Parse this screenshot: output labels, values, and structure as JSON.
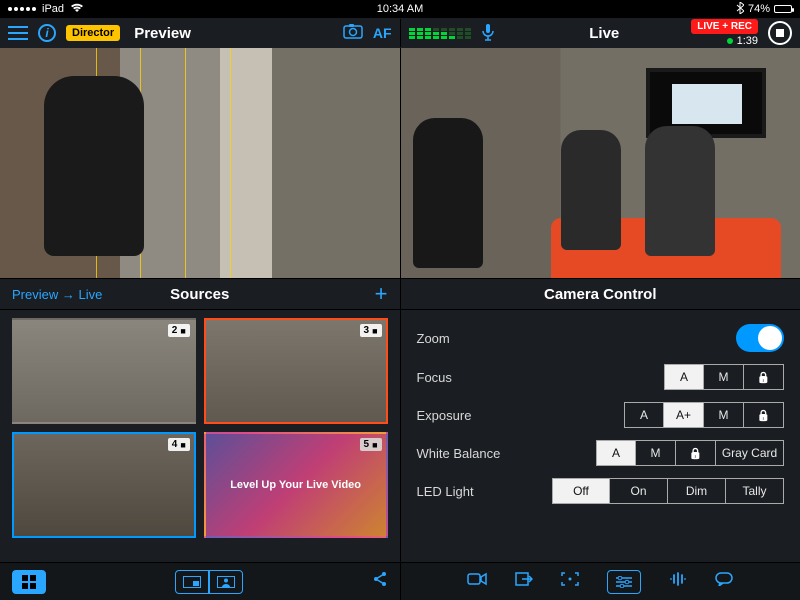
{
  "statusbar": {
    "device": "iPad",
    "time": "10:34 AM",
    "battery": "74%"
  },
  "header": {
    "director_badge": "Director",
    "preview_title": "Preview",
    "af_label": "AF",
    "live_title": "Live",
    "live_badge": "LIVE + REC",
    "rec_time": "1:39"
  },
  "section": {
    "preview_to_live": "Preview → Live",
    "sources_title": "Sources",
    "camera_control_title": "Camera Control"
  },
  "sources": [
    {
      "index": "2",
      "selected": "none"
    },
    {
      "index": "3",
      "selected": "orange"
    },
    {
      "index": "4",
      "selected": "blue"
    },
    {
      "index": "5",
      "selected": "none",
      "overlay": "Level Up Your Live Video"
    }
  ],
  "controls": {
    "zoom": {
      "label": "Zoom",
      "on": true
    },
    "focus": {
      "label": "Focus",
      "options": [
        "A",
        "M",
        "Lock"
      ],
      "active": "A"
    },
    "exposure": {
      "label": "Exposure",
      "options": [
        "A",
        "A+",
        "M",
        "Lock"
      ],
      "active": "A+"
    },
    "white_balance": {
      "label": "White Balance",
      "options": [
        "A",
        "M",
        "Lock",
        "Gray Card"
      ],
      "active": "A"
    },
    "led": {
      "label": "LED Light",
      "options": [
        "Off",
        "On",
        "Dim",
        "Tally"
      ],
      "active": "Off"
    }
  }
}
